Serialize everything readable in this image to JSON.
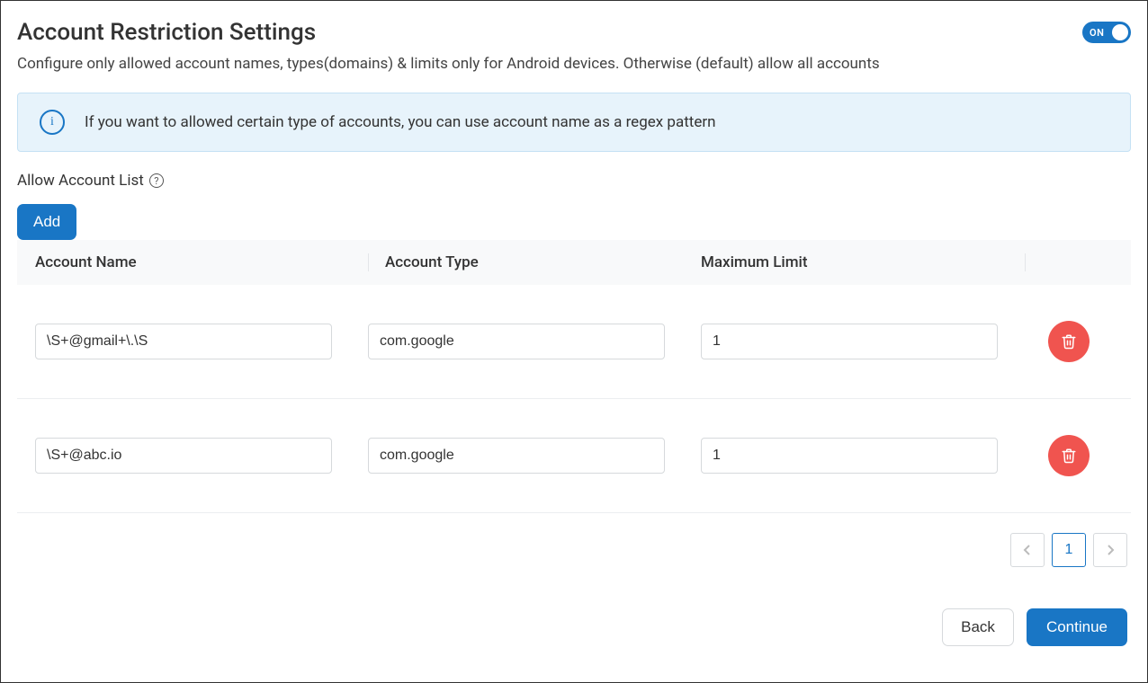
{
  "header": {
    "title": "Account Restriction Settings",
    "toggle_state": "ON"
  },
  "subtitle": "Configure only allowed account names, types(domains) & limits only for Android devices. Otherwise (default) allow all accounts",
  "info_banner": "If you want to allowed certain type of accounts, you can use account name as a regex pattern",
  "section_label": "Allow Account List",
  "add_button": "Add",
  "table": {
    "headers": {
      "account_name": "Account Name",
      "account_type": "Account Type",
      "max_limit": "Maximum Limit"
    },
    "rows": [
      {
        "name": "\\S+@gmail+\\.\\S",
        "type": "com.google",
        "limit": "1"
      },
      {
        "name": "\\S+@abc.io",
        "type": "com.google",
        "limit": "1"
      }
    ]
  },
  "pagination": {
    "prev": "<",
    "current": "1",
    "next": ">"
  },
  "footer": {
    "back": "Back",
    "continue": "Continue"
  }
}
